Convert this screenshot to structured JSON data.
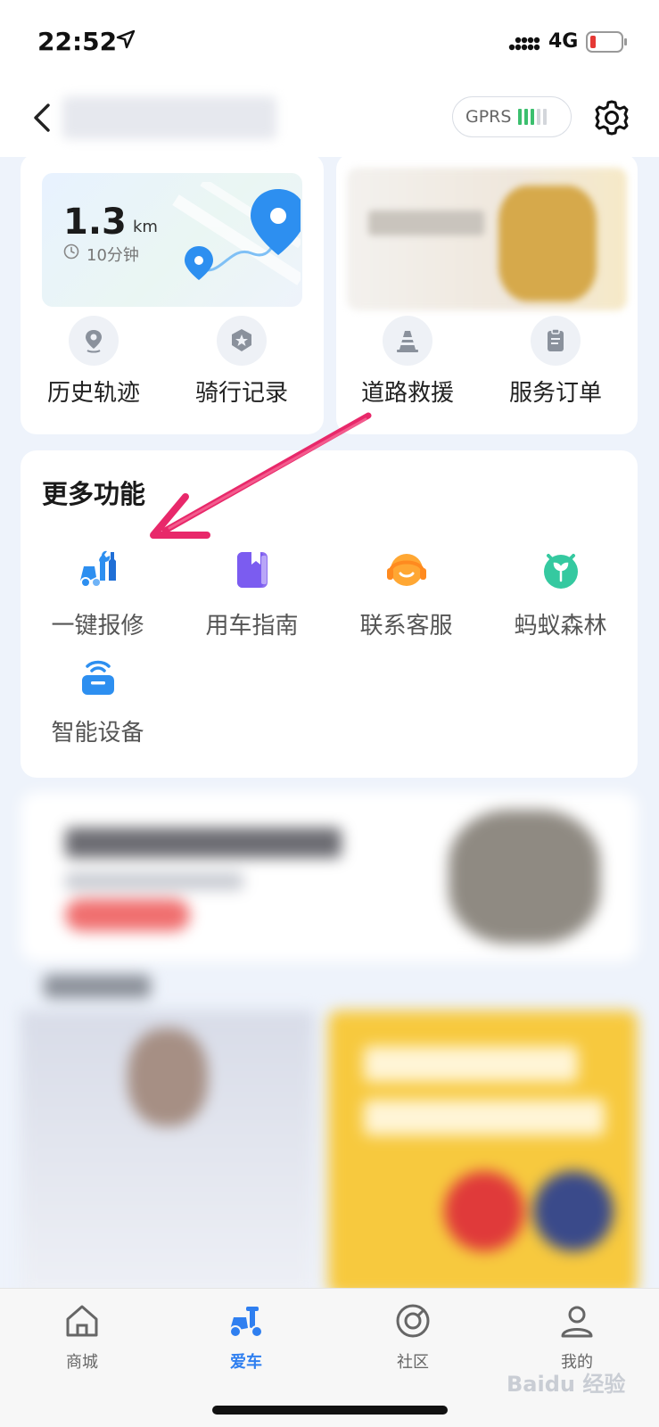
{
  "status_bar": {
    "time": "22:52",
    "network": "4G"
  },
  "nav": {
    "gprs_label": "GPRS",
    "gprs_signal_active": 3,
    "gprs_signal_total": 5
  },
  "trip": {
    "distance": "1.3",
    "unit": "km",
    "duration": "10分钟"
  },
  "quick_actions": [
    {
      "label": "历史轨迹",
      "icon": "map-pin-icon"
    },
    {
      "label": "骑行记录",
      "icon": "badge-icon"
    },
    {
      "label": "道路救援",
      "icon": "traffic-cone-icon"
    },
    {
      "label": "服务订单",
      "icon": "clipboard-icon"
    }
  ],
  "more_features": {
    "title": "更多功能",
    "items": [
      {
        "label": "一键报修",
        "icon": "repair-wrench-icon"
      },
      {
        "label": "用车指南",
        "icon": "guide-book-icon"
      },
      {
        "label": "联系客服",
        "icon": "headset-icon"
      },
      {
        "label": "蚂蚁森林",
        "icon": "sprout-icon"
      },
      {
        "label": "智能设备",
        "icon": "wifi-device-icon"
      }
    ]
  },
  "tabs": [
    {
      "label": "商城",
      "icon": "home-icon",
      "active": false
    },
    {
      "label": "爱车",
      "icon": "scooter-icon",
      "active": true
    },
    {
      "label": "社区",
      "icon": "compass-icon",
      "active": false
    },
    {
      "label": "我的",
      "icon": "user-icon",
      "active": false
    }
  ],
  "watermark": "Baidu 经验",
  "colors": {
    "accent": "#2f7ff0",
    "arrow": "#e8286a",
    "signal_green": "#3cbf6e"
  }
}
